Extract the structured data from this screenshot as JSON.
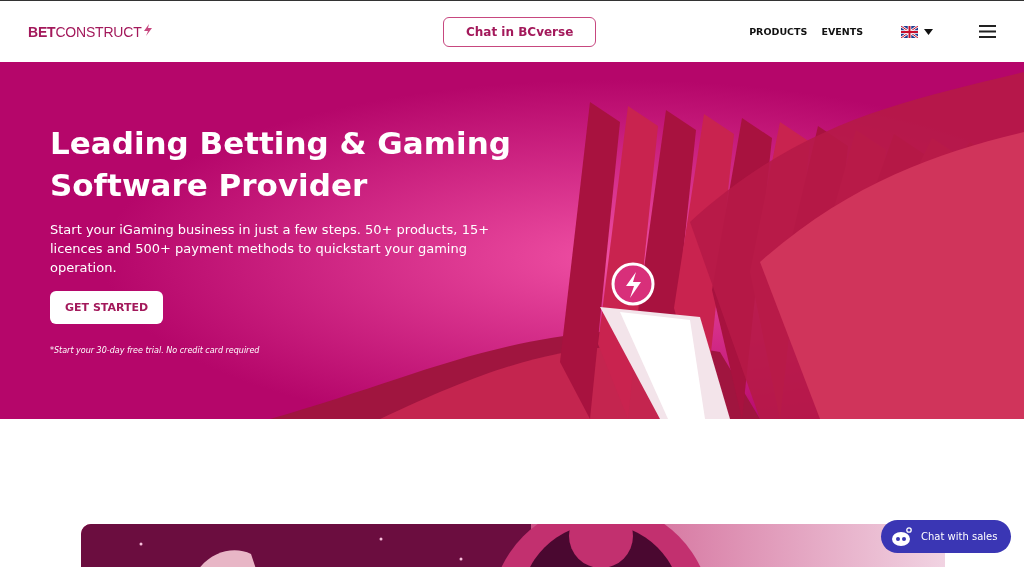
{
  "header": {
    "logo": "**BET**CONSTRUCT",
    "chat_button": "Chat in BCverse",
    "nav": [
      "PRODUCTS",
      "EVENTS"
    ]
  },
  "hero": {
    "title": "Leading Betting & Gaming Software Provider",
    "subtitle": "Start your iGaming business in just a few steps. 50+ products, 15+ licences and 500+ payment methods to quickstart your gaming operation.",
    "button": "GET STARTED",
    "note": "*Start your 30-day free trial. No credit card required",
    "kind": "picture"
  },
  "chat_widget": {
    "label": "Chat with sales"
  }
}
